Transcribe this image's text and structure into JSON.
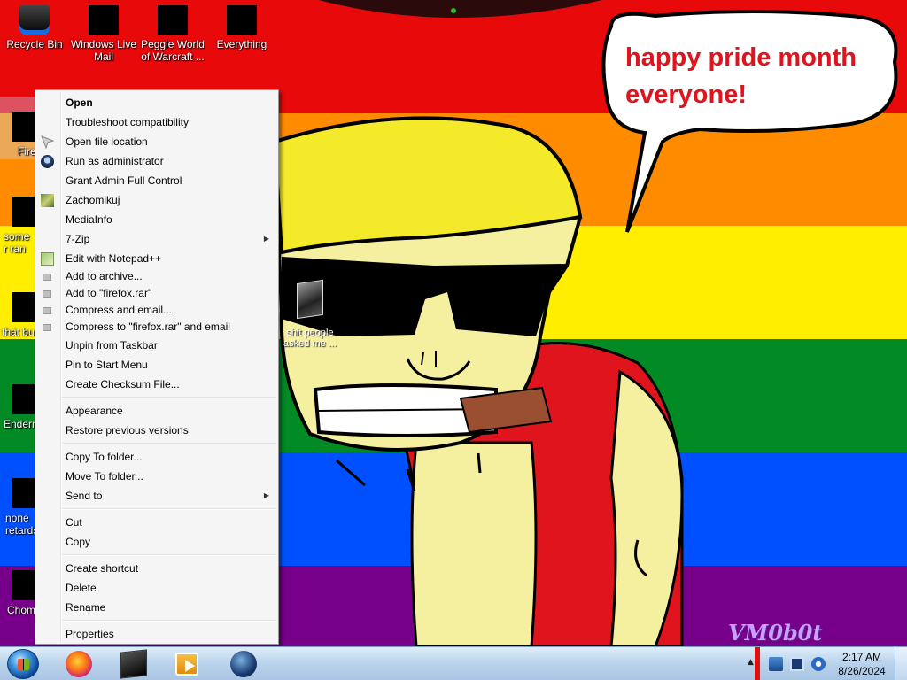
{
  "desktop": {
    "icons": [
      {
        "label": "Recycle Bin",
        "icon": "recycle-bin-icon"
      },
      {
        "label": "Windows Live Mail",
        "icon": "mail-icon"
      },
      {
        "label": "Peggle World of Warcraft ...",
        "icon": "peggle-icon"
      },
      {
        "label": "Everything",
        "icon": "search-icon"
      },
      {
        "label": "Fire",
        "icon": "firefox-shortcut-icon"
      },
      {
        "label": "some r ran",
        "icon": "shortcut-icon"
      },
      {
        "label": "that bu",
        "icon": "shortcut-icon"
      },
      {
        "label": "Enderm",
        "icon": "shortcut-icon"
      },
      {
        "label": "none retards",
        "icon": "shortcut-icon"
      },
      {
        "label": "Chom",
        "icon": "shortcut-icon"
      }
    ],
    "file": {
      "label": "shit people asked me ...",
      "icon": "file-icon"
    }
  },
  "wallpaper": {
    "speech": "happy pride month everyone!",
    "signature": "VM0b0t",
    "colors": {
      "red": "#e8090b",
      "orange": "#ff8c00",
      "yellow": "#ffee00",
      "green": "#028a25",
      "blue": "#0050ff",
      "purple": "#760089"
    }
  },
  "context_menu": {
    "items": [
      {
        "label": "Open",
        "bold": true
      },
      {
        "label": "Troubleshoot compatibility"
      },
      {
        "label": "Open file location"
      },
      {
        "label": "Run as administrator",
        "icon": "shield-icon"
      },
      {
        "label": "Grant Admin Full Control"
      },
      {
        "label": "Zachomikuj",
        "icon": "zachomikuj-icon"
      },
      {
        "label": "MediaInfo"
      },
      {
        "label": "7-Zip",
        "submenu": true
      },
      {
        "label": "Edit with Notepad++",
        "icon": "notepad-plus-icon"
      },
      {
        "label": "Add to archive...",
        "icon": "archive-icon"
      },
      {
        "label": "Add to \"firefox.rar\"",
        "icon": "archive-icon"
      },
      {
        "label": "Compress and email...",
        "icon": "archive-icon"
      },
      {
        "label": "Compress to \"firefox.rar\" and email",
        "icon": "archive-icon"
      },
      {
        "label": "Unpin from Taskbar"
      },
      {
        "label": "Pin to Start Menu"
      },
      {
        "label": "Create Checksum File..."
      },
      {
        "label": "Appearance"
      },
      {
        "label": "Restore previous versions"
      },
      {
        "label": "Copy To folder..."
      },
      {
        "label": "Move To folder..."
      },
      {
        "label": "Send to",
        "submenu": true
      },
      {
        "label": "Cut"
      },
      {
        "label": "Copy"
      },
      {
        "label": "Create shortcut"
      },
      {
        "label": "Delete"
      },
      {
        "label": "Rename"
      },
      {
        "label": "Properties"
      }
    ]
  },
  "taskbar": {
    "start_icon": "windows-start-icon",
    "pinned": [
      {
        "icon": "firefox-icon"
      },
      {
        "icon": "terminal-icon"
      },
      {
        "icon": "media-player-icon"
      },
      {
        "icon": "globe-icon"
      }
    ],
    "tray": {
      "icons": [
        "network-icon",
        "monitor-icon",
        "volume-icon"
      ],
      "time": "2:17 AM",
      "date": "8/26/2024"
    }
  }
}
